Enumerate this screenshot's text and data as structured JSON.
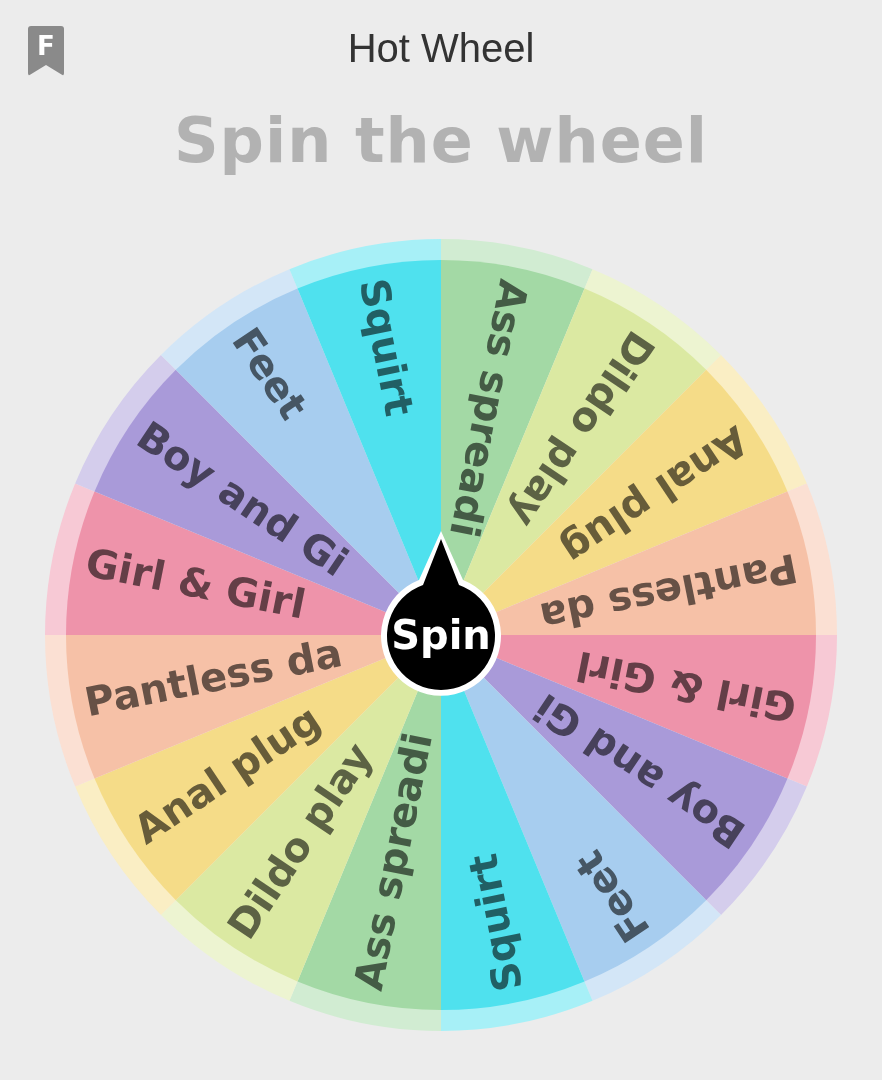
{
  "header": {
    "badge": "F",
    "title": "Hot Wheel"
  },
  "heading": "Spin the wheel",
  "wheel": {
    "segments": [
      {
        "label": "Ass spreadi",
        "color": "#a3d9a5"
      },
      {
        "label": "Dildo play",
        "color": "#dbe9a2"
      },
      {
        "label": "Anal plug",
        "color": "#f5dc88"
      },
      {
        "label": "Pantless da",
        "color": "#f6c1a7"
      },
      {
        "label": "Girl & Girl",
        "color": "#ee93aa"
      },
      {
        "label": "Boy and Gi",
        "color": "#a99ad9"
      },
      {
        "label": "Feet",
        "color": "#a7cdef"
      },
      {
        "label": "Squirt",
        "color": "#4fe1ee"
      },
      {
        "label": "Ass spreadi",
        "color": "#a3d9a5"
      },
      {
        "label": "Dildo play",
        "color": "#dbe9a2"
      },
      {
        "label": "Anal plug",
        "color": "#f5dc88"
      },
      {
        "label": "Pantless da",
        "color": "#f6c1a7"
      },
      {
        "label": "Girl & Girl",
        "color": "#ee93aa"
      },
      {
        "label": "Boy and Gi",
        "color": "#a99ad9"
      },
      {
        "label": "Feet",
        "color": "#a7cdef"
      },
      {
        "label": "Squirt",
        "color": "#4fe1ee"
      }
    ]
  },
  "spin_button": "Spin"
}
